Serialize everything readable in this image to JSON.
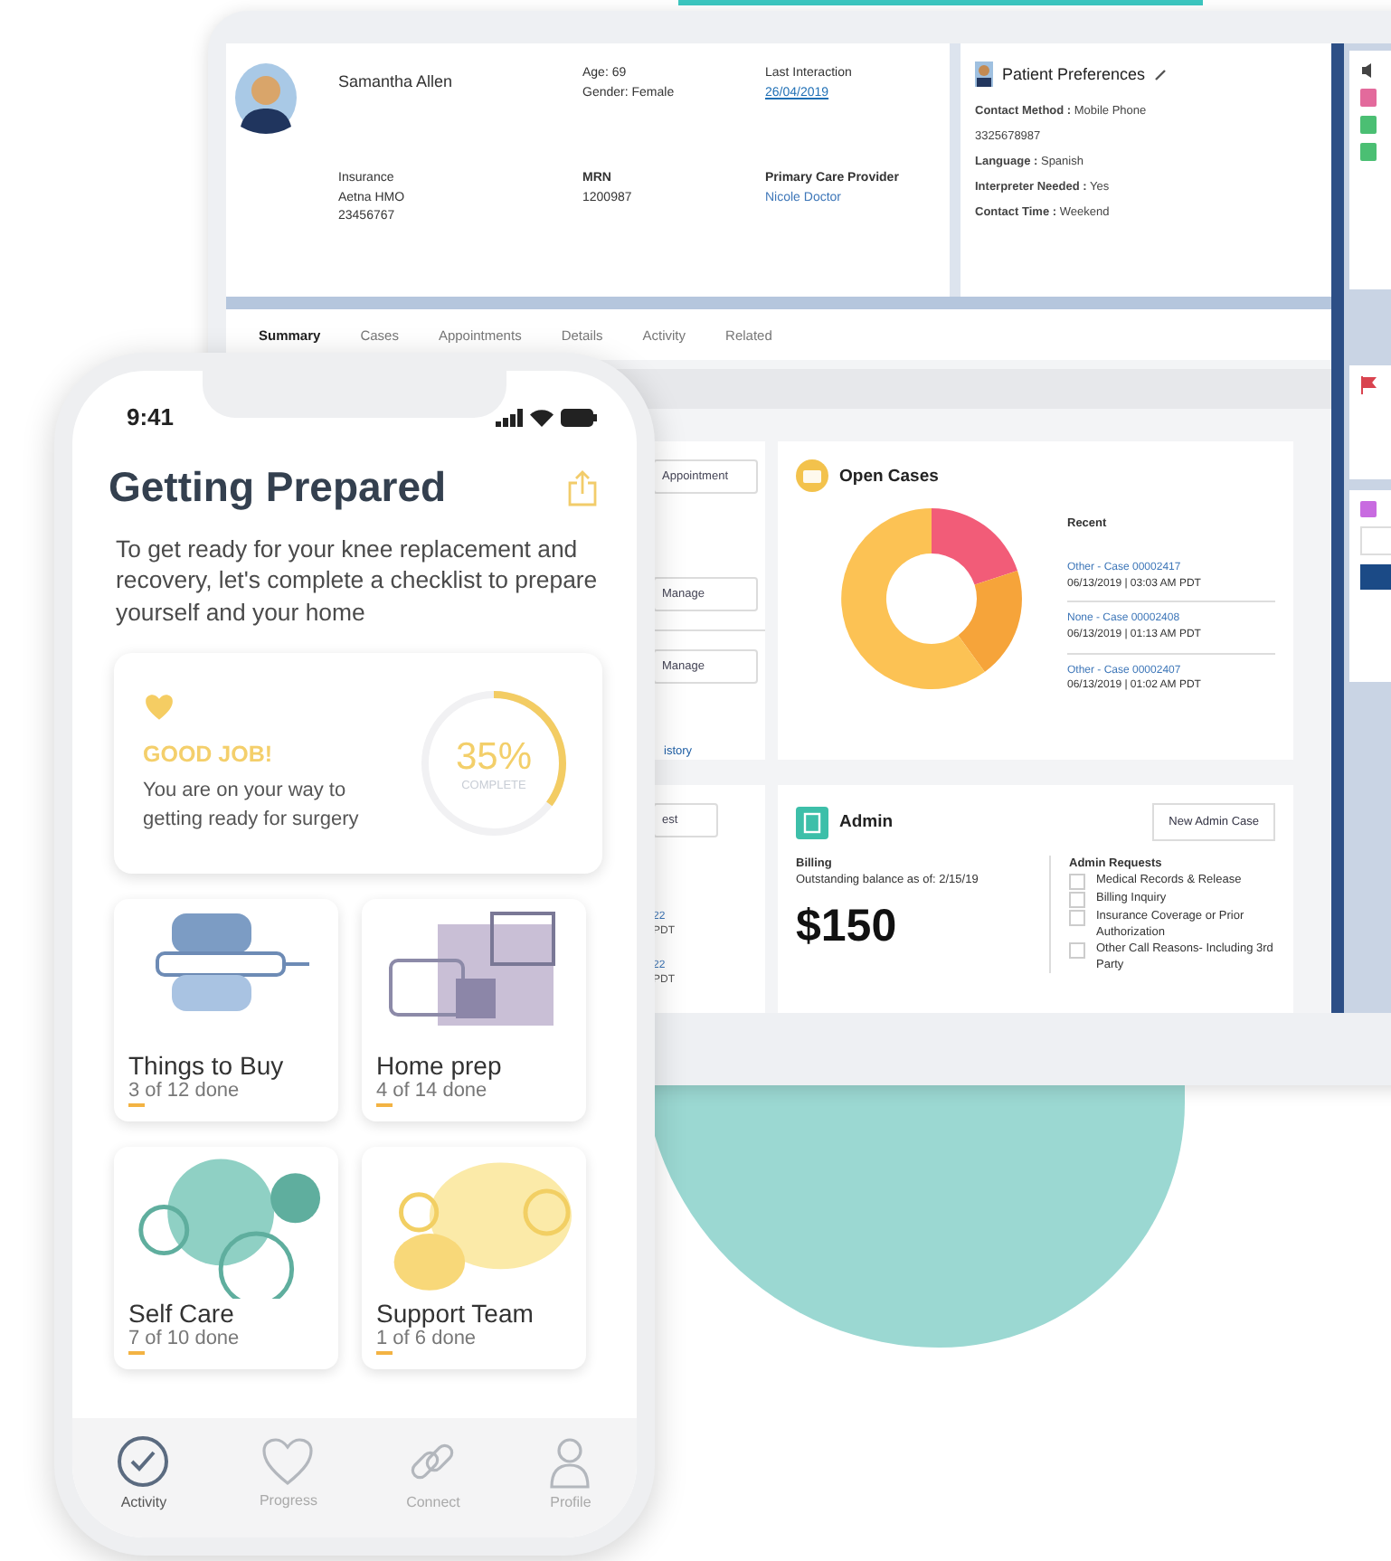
{
  "laptop": {
    "patient": {
      "name": "Samantha Allen",
      "age_label": "Age:",
      "age": "69",
      "gender_label": "Gender:",
      "gender": "Female",
      "last_label": "Last Interaction",
      "last_value": "26/04/2019",
      "insurance_label": "Insurance",
      "insurance_lines": [
        "Aetna HMO",
        "23456767"
      ],
      "mrn_label": "MRN",
      "mrn": "1200987",
      "provider_label": "Primary Care Provider",
      "provider": "Nicole Doctor"
    },
    "preferences": {
      "title": "Patient Preferences",
      "rows": [
        {
          "label": "Contact Method :",
          "value": "Mobile Phone"
        },
        {
          "value": "3325678987"
        },
        {
          "label": "Language :",
          "value": "Spanish"
        },
        {
          "label": "Interpreter Needed :",
          "value": "Yes"
        },
        {
          "label": "Contact Time :",
          "value": "Weekend"
        }
      ]
    },
    "tabs": [
      {
        "label": "Summary",
        "selected": true
      },
      {
        "label": "Cases",
        "selected": false
      },
      {
        "label": "Appointments",
        "selected": false
      },
      {
        "label": "Details",
        "selected": false
      },
      {
        "label": "Activity",
        "selected": false
      },
      {
        "label": "Related",
        "selected": false
      }
    ],
    "left_card": {
      "buttons": [
        "Appointment",
        "Manage",
        "Manage"
      ],
      "link": "istory"
    },
    "left_card_2": {
      "button": "est",
      "fragments": [
        {
          "line_1": "22",
          "line_2": "PDT"
        },
        {
          "line_1": "22",
          "line_2": "PDT"
        }
      ]
    },
    "open_cases": {
      "title": "Open Cases",
      "recent_label": "Recent",
      "cases": [
        {
          "title": "Other - Case 00002417",
          "time": "06/13/2019 | 03:03 AM PDT"
        },
        {
          "title": "None - Case 00002408",
          "time": "06/13/2019 | 01:13 AM PDT"
        },
        {
          "title": "Other - Case 00002407",
          "time": "06/13/2019 | 01:02 AM PDT"
        }
      ]
    },
    "admin": {
      "title": "Admin",
      "button": "New Admin Case",
      "billing_label": "Billing",
      "billing_text": "Outstanding balance as of: 2/15/19",
      "amount": "$150",
      "requests_label": "Admin Requests",
      "requests": [
        {
          "label": "Medical Records & Release",
          "checked": false
        },
        {
          "label": "Billing Inquiry",
          "checked": false
        },
        {
          "label": "Insurance Coverage or Prior Authorization",
          "checked": false
        },
        {
          "label": "Other Call Reasons- Including 3rd Party",
          "checked": false
        }
      ]
    }
  },
  "phone": {
    "time": "9:41",
    "title": "Getting Prepared",
    "intro": "To get ready for your knee replacement and recovery, let's complete a checklist to prepare yourself and your home",
    "progress": {
      "heading": "GOOD JOB!",
      "text": "You are on your way to getting ready for surgery",
      "percent": "35%",
      "caption": "COMPLETE",
      "level": 0.35
    },
    "tiles": [
      {
        "kind": "buy",
        "title": "Things to Buy",
        "count": "3 of 12 done"
      },
      {
        "kind": "home",
        "title": "Home prep",
        "count": "4 of 14 done"
      },
      {
        "kind": "care",
        "title": "Self Care",
        "count": "7 of 10 done"
      },
      {
        "kind": "team",
        "title": "Support Team",
        "count": "1 of 6 done"
      }
    ],
    "tab_bar": [
      {
        "kind": "activity",
        "label": "Activity",
        "selected": true
      },
      {
        "kind": "progress",
        "label": "Progress",
        "selected": false
      },
      {
        "kind": "connect",
        "label": "Connect",
        "selected": false
      },
      {
        "kind": "profile",
        "label": "Profile",
        "selected": false
      }
    ]
  }
}
